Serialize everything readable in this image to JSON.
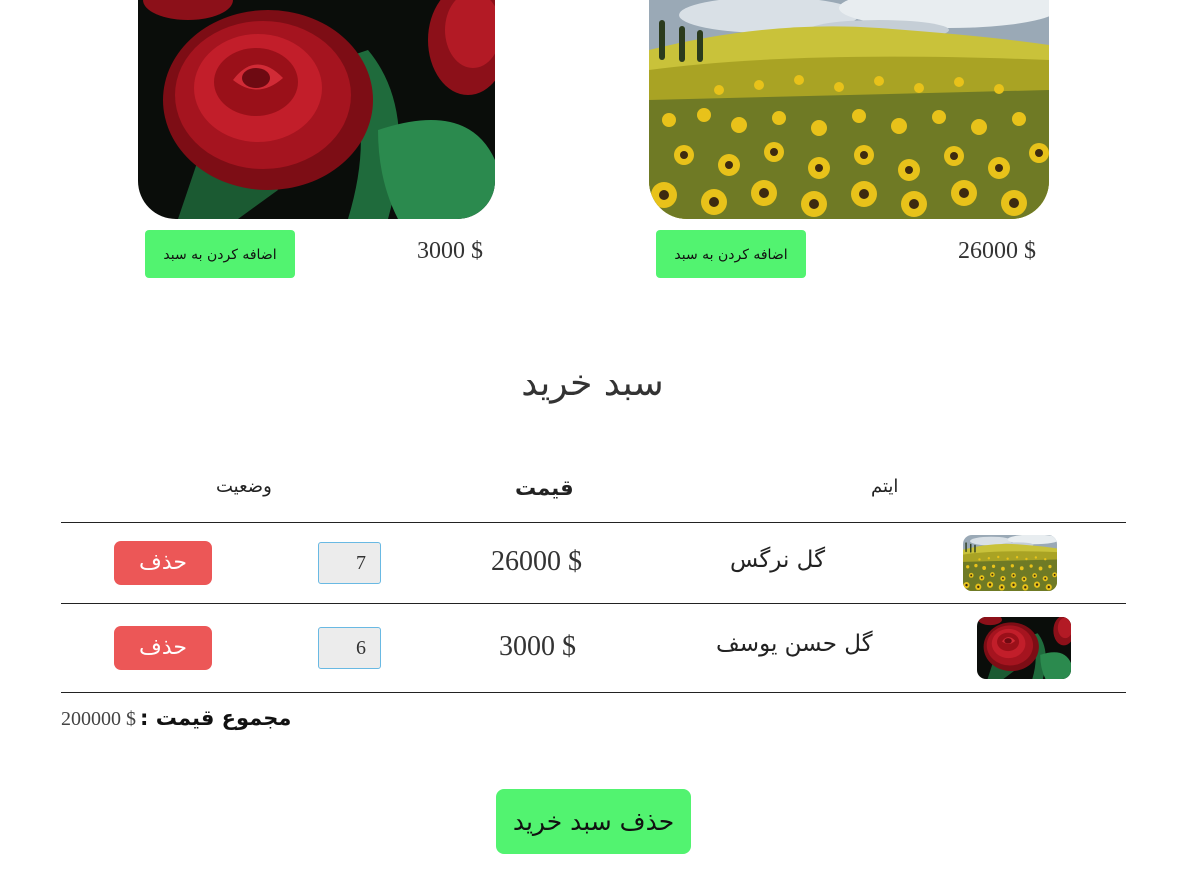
{
  "products": [
    {
      "image": "rose-image",
      "price": "3000 $",
      "add_label": "اضافه کردن به سبد"
    },
    {
      "image": "sunflower-field-image",
      "price": "26000 $",
      "add_label": "اضافه کردن به سبد"
    }
  ],
  "cart": {
    "title": "سبد خرید",
    "headers": {
      "item": "ایتم",
      "price": "قیمت",
      "status": "وضعیت"
    },
    "rows": [
      {
        "image": "sunflower-thumbnail",
        "name": "گل نرگس",
        "price": "26000 $",
        "quantity": "7",
        "remove_label": "حذف"
      },
      {
        "image": "rose-thumbnail",
        "name": "گل حسن یوسف",
        "price": "3000 $",
        "quantity": "6",
        "remove_label": "حذف"
      }
    ],
    "total_label": "مجموع قیمت :",
    "total_value": "200000 $",
    "clear_label": "حذف سبد خرید"
  },
  "colors": {
    "add_button": "#52f370",
    "remove_button": "#ec5757",
    "quantity_border": "#69b9e3"
  }
}
